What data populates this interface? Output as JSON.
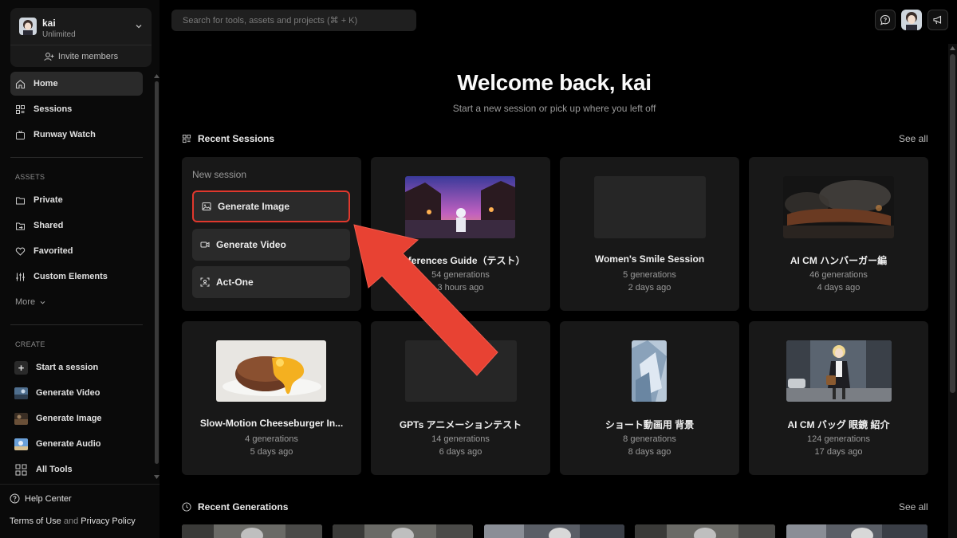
{
  "profile": {
    "name": "kai",
    "plan": "Unlimited",
    "invite_label": "Invite members"
  },
  "nav": [
    {
      "label": "Home",
      "icon": "home-icon",
      "active": true
    },
    {
      "label": "Sessions",
      "icon": "sessions-icon"
    },
    {
      "label": "Runway Watch",
      "icon": "tv-icon"
    }
  ],
  "assets": {
    "heading": "ASSETS",
    "items": [
      {
        "label": "Private",
        "icon": "folder-icon"
      },
      {
        "label": "Shared",
        "icon": "shared-folder-icon"
      },
      {
        "label": "Favorited",
        "icon": "heart-icon"
      },
      {
        "label": "Custom Elements",
        "icon": "sliders-icon"
      }
    ],
    "more_label": "More"
  },
  "create": {
    "heading": "CREATE",
    "items": [
      {
        "label": "Start a session"
      },
      {
        "label": "Generate Video"
      },
      {
        "label": "Generate Image"
      },
      {
        "label": "Generate Audio"
      },
      {
        "label": "All Tools"
      }
    ]
  },
  "footer": {
    "help": "Help Center",
    "terms": "Terms of Use",
    "and": "and",
    "privacy": "Privacy Policy"
  },
  "search": {
    "placeholder": "Search for tools, assets and projects (⌘ + K)"
  },
  "welcome": {
    "title": "Welcome back, kai",
    "subtitle": "Start a new session or pick up where you left off"
  },
  "recent_sessions": {
    "heading": "Recent Sessions",
    "see_all": "See all",
    "new_session": {
      "label": "New session",
      "buttons": [
        "Generate Image",
        "Generate Video",
        "Act-One"
      ]
    },
    "cards": [
      {
        "title": "References Guide（テスト）",
        "generations": "54 generations",
        "time": "3 hours ago"
      },
      {
        "title": "Women's Smile Session",
        "generations": "5 generations",
        "time": "2 days ago"
      },
      {
        "title": "AI CM ハンバーガー編",
        "generations": "46 generations",
        "time": "4 days ago"
      },
      {
        "title": "Slow-Motion Cheeseburger In...",
        "generations": "4 generations",
        "time": "5 days ago"
      },
      {
        "title": "GPTs アニメーションテスト",
        "generations": "14 generations",
        "time": "6 days ago"
      },
      {
        "title": "ショート動画用 背景",
        "generations": "8 generations",
        "time": "8 days ago"
      },
      {
        "title": "AI CM バッグ 眼鏡 紹介",
        "generations": "124 generations",
        "time": "17 days ago"
      }
    ]
  },
  "recent_generations": {
    "heading": "Recent Generations",
    "see_all": "See all"
  },
  "colors": {
    "accent_red": "#e0382d",
    "card_bg": "#181818",
    "page_bg": "#000000"
  }
}
